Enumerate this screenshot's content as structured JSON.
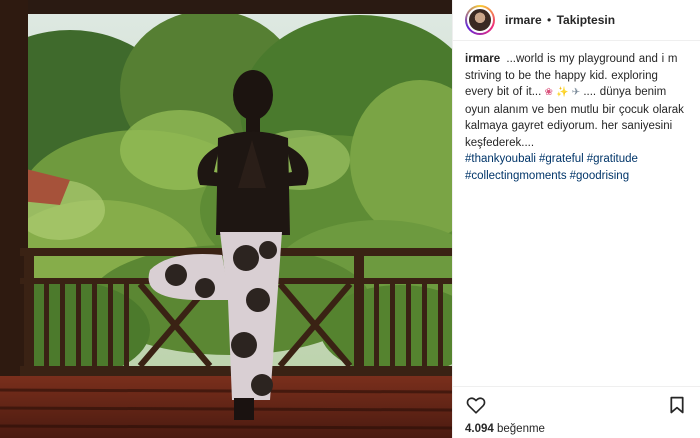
{
  "post": {
    "username": "irmare",
    "separator": "•",
    "follow_label": "Takiptesin",
    "caption": {
      "username": "irmare",
      "text_before": "...world is my playground and i m striving to be the happy kid. exploring every bit of it...",
      "emoji_rose": "❀",
      "emoji_sparkle": "✨",
      "emoji_plane": "✈",
      "text_after": ".... dünya benim oyun alanım ve ben mutlu bir çocuk olarak kalmaya gayret ediyorum. her saniyesini keşfederek....",
      "hashtags": [
        "#thankyoubali",
        "#grateful",
        "#gratitude",
        "#collectingmoments",
        "#goodrising"
      ]
    },
    "likes": {
      "count": "4.094",
      "label": "beğenme"
    },
    "icons": {
      "like": "heart-icon",
      "save": "bookmark-icon"
    },
    "colors": {
      "hashtag": "#003569",
      "text": "#262626",
      "border": "#efefef"
    }
  }
}
